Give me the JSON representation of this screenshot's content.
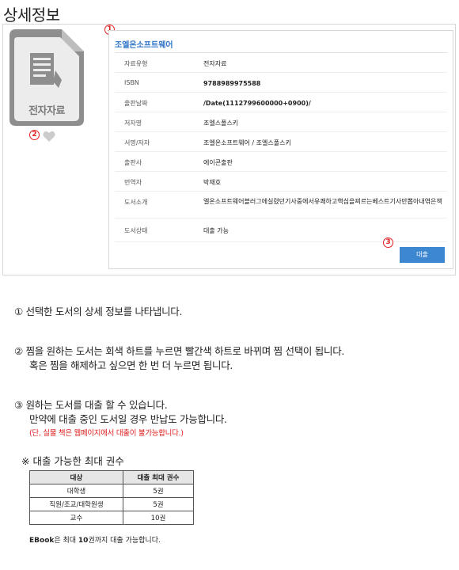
{
  "page": {
    "title": "상세정보"
  },
  "cover": {
    "label": "전자자료"
  },
  "markers": {
    "m1": "1",
    "m2": "2",
    "m3": "3"
  },
  "detail": {
    "title": "조엘온소프트웨어",
    "rows": [
      {
        "label": "자료유형",
        "value": "전자자료"
      },
      {
        "label": "ISBN",
        "value": "9788989975588"
      },
      {
        "label": "출판날짜",
        "value": "/Date(1112799600000+0900)/"
      },
      {
        "label": "저자명",
        "value": "조엘스폴스키"
      },
      {
        "label": "서명/저자",
        "value": "조엘온소프트웨어 / 조엘스폴스키"
      },
      {
        "label": "출판사",
        "value": "에이콘출판"
      },
      {
        "label": "번역자",
        "value": "박재호"
      },
      {
        "label": "도서소개",
        "value": "엘온소프트웨어블러그에실렸던기사중에서유쾌하고핵심을찌르는베스트기사만뽑아내엮은책"
      },
      {
        "label": "도서상태",
        "value": "대출 가능"
      }
    ],
    "loan_button": "대출"
  },
  "notes": {
    "n1": "① 선택한 도서의 상세 정보를 나타냅니다.",
    "n2_line1": "② 찜을 원하는 도서는 회색 하트를 누르면 빨간색 하트로 바뀌며 찜 선택이 됩니다.",
    "n2_line2": "혹은 찜을 해제하고 싶으면 한 번 더 누르면 됩니다.",
    "n3_line1": "③ 원하는 도서를 대출 할 수 있습니다.",
    "n3_line2": "만약에 대출 중인 도서일 경우 반납도 가능합니다.",
    "n3_line3": "(단, 실물 책은 웹페이지에서 대출이 불가능합니다.)"
  },
  "limits": {
    "title": "※ 대출 가능한 최대 권수",
    "headers": [
      "대상",
      "대출 최대 권수"
    ],
    "rows": [
      [
        "대학생",
        "5권"
      ],
      [
        "직원/조교/대학원생",
        "5권"
      ],
      [
        "교수",
        "10권"
      ]
    ],
    "foot_strong1": "EBook",
    "foot_mid": "은 최대 ",
    "foot_strong2": "10",
    "foot_end": "권까지 대출 가능합니다."
  },
  "colors": {
    "accent": "#2f75c7",
    "button": "#3d87d1",
    "marker": "#e02020",
    "heart": "#cccccc"
  }
}
